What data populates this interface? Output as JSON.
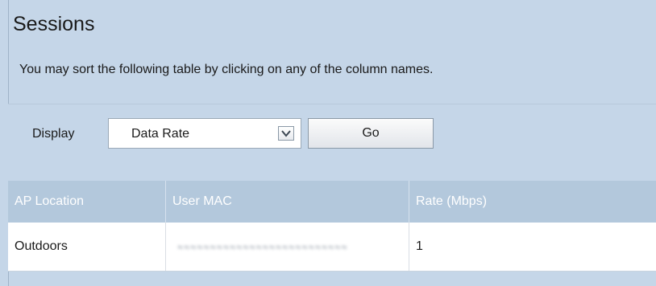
{
  "page": {
    "title": "Sessions",
    "description": "You may sort the following table by clicking on any of the column names."
  },
  "toolbar": {
    "display_label": "Display",
    "select": {
      "selected": "Data Rate",
      "icon": "chevron-down-icon"
    },
    "go_label": "Go"
  },
  "table": {
    "columns": [
      "AP Location",
      "User MAC",
      "Rate (Mbps)"
    ],
    "rows": [
      {
        "ap_location": "Outdoors",
        "user_mac": "",
        "rate": "1"
      }
    ]
  },
  "colors": {
    "background": "#c5d6e8",
    "header": "#b3c8dc",
    "row": "#ffffff"
  }
}
